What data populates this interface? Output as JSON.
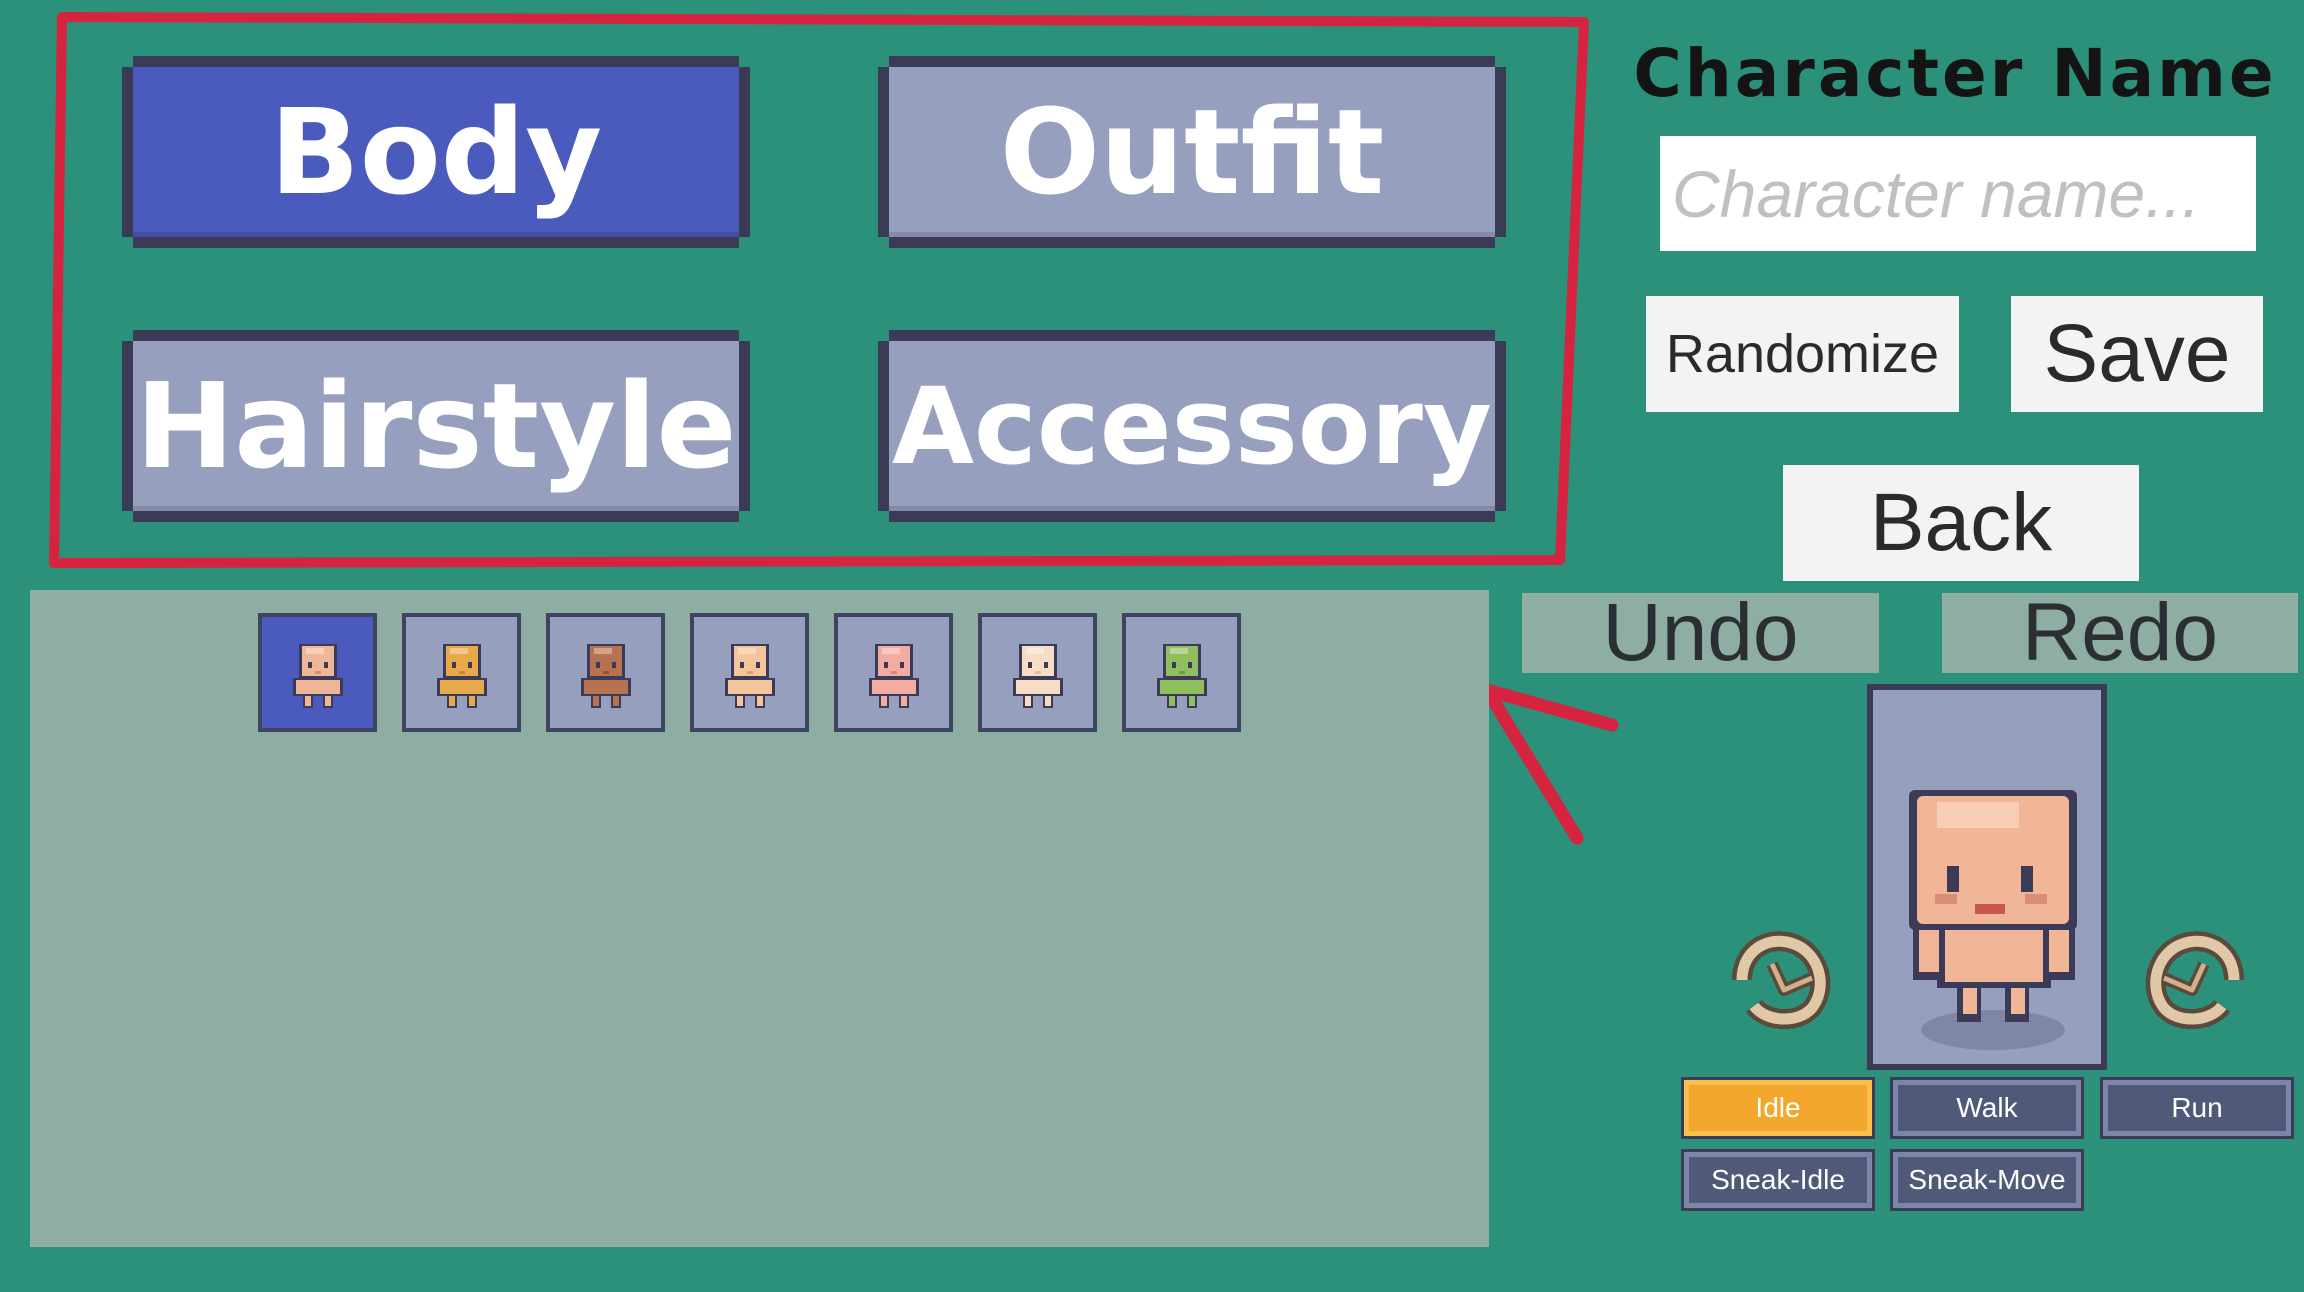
{
  "tabs": {
    "body": "Body",
    "outfit": "Outfit",
    "hairstyle": "Hairstyle",
    "accessory": "Accessory"
  },
  "name_panel": {
    "title": "Character Name",
    "placeholder": "Character name..."
  },
  "actions": {
    "randomize": "Randomize",
    "save": "Save",
    "back": "Back",
    "undo": "Undo",
    "redo": "Redo"
  },
  "swatches": [
    {
      "skin": "#f1b598",
      "shade": "#d98d76",
      "selected": true
    },
    {
      "skin": "#e8a94a",
      "shade": "#c98634",
      "selected": false
    },
    {
      "skin": "#b9724f",
      "shade": "#93553a",
      "selected": false
    },
    {
      "skin": "#f4c49a",
      "shade": "#dca17a",
      "selected": false
    },
    {
      "skin": "#f3aca2",
      "shade": "#d9877f",
      "selected": false
    },
    {
      "skin": "#f7dcc6",
      "shade": "#dcbda6",
      "selected": false
    },
    {
      "skin": "#8fbf5e",
      "shade": "#6e9c44",
      "selected": false
    }
  ],
  "animations": {
    "idle": "Idle",
    "walk": "Walk",
    "run": "Run",
    "sneak_idle": "Sneak-Idle",
    "sneak_move": "Sneak-Move",
    "selected": "Idle"
  },
  "colors": {
    "background": "#2b917a",
    "tab_active": "#4a5bbd",
    "tab_inactive": "#979fbf",
    "annotation": "#d62440",
    "anim_selected": "#f3a72c"
  },
  "icons": {
    "rotate_left": "rotate-left-icon",
    "rotate_right": "rotate-right-icon"
  }
}
